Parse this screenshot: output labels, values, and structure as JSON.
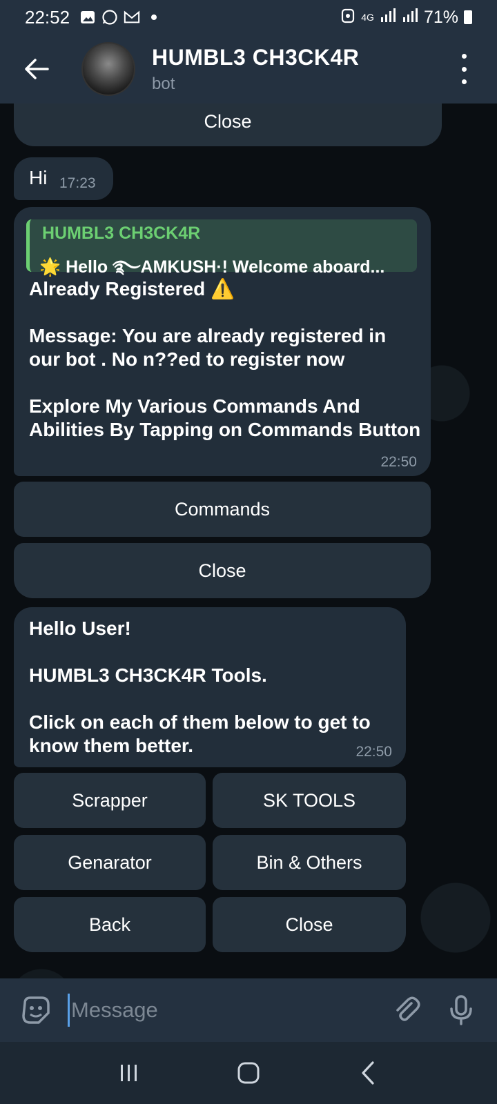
{
  "status_bar": {
    "time": "22:52",
    "network": "4G",
    "battery": "71%"
  },
  "header": {
    "title": "HUMBL3 CH3CK4R",
    "subtitle": "bot"
  },
  "top_close_label": "Close",
  "hi_message": {
    "text": "Hi",
    "time": "17:23"
  },
  "main_message": {
    "reply_author": "HUMBL3 CH3CK4R",
    "reply_text": "🌟 Hello ࿐AMKUSH·!  Welcome aboard...",
    "line1": "Already Registered ⚠️",
    "line2": "Message: You are already registered in our bot . No n??ed to register now",
    "line3": "Explore My Various Commands And Abilities By Tapping on Commands Button",
    "time": "22:50"
  },
  "main_buttons": {
    "commands": "Commands",
    "close": "Close"
  },
  "tools_message": {
    "line1": "Hello User!",
    "line2": "HUMBL3 CH3CK4R Tools.",
    "line3": "Click on each of them below to get to know them better.",
    "time": "22:50"
  },
  "tool_buttons": {
    "scrapper": "Scrapper",
    "sk_tools": "SK TOOLS",
    "genarator": "Genarator",
    "bin_others": "Bin & Others",
    "back": "Back",
    "close": "Close"
  },
  "input": {
    "placeholder": "Message"
  }
}
